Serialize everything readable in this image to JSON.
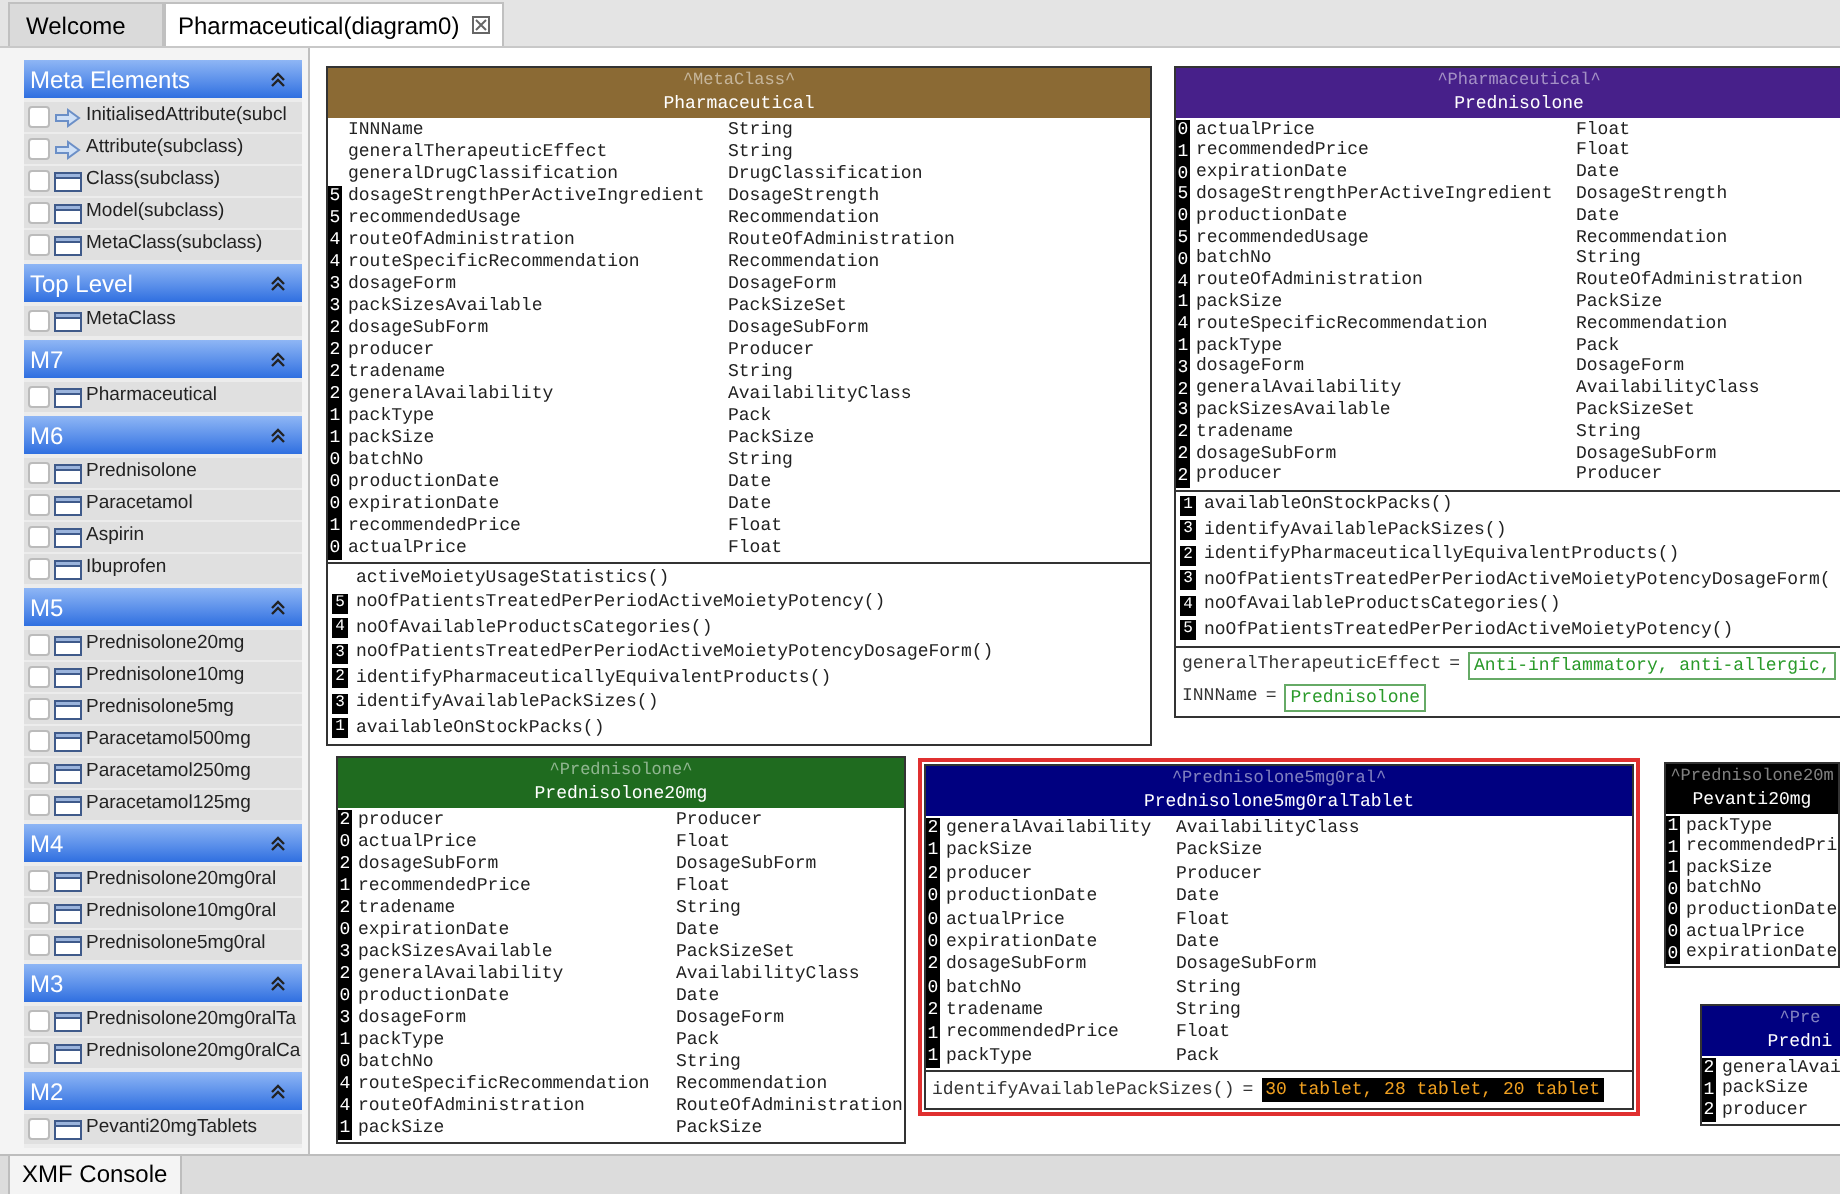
{
  "tabs": [
    {
      "label": "Welcome",
      "selected": false,
      "closable": false
    },
    {
      "label": "Pharmaceutical(diagram0)",
      "selected": true,
      "closable": true
    }
  ],
  "palette": {
    "sections": [
      {
        "title": "Meta Elements",
        "items": [
          {
            "label": "InitialisedAttribute(subcl",
            "kind": "arrow",
            "checked": false
          },
          {
            "label": "Attribute(subclass)",
            "kind": "arrow",
            "checked": false
          },
          {
            "label": "Class(subclass)",
            "kind": "class",
            "checked": false
          },
          {
            "label": "Model(subclass)",
            "kind": "class",
            "checked": false
          },
          {
            "label": "MetaClass(subclass)",
            "kind": "class",
            "checked": false
          }
        ]
      },
      {
        "title": "Top Level",
        "items": [
          {
            "label": "MetaClass",
            "kind": "class",
            "checked": false
          }
        ]
      },
      {
        "title": "M7",
        "items": [
          {
            "label": "Pharmaceutical",
            "kind": "class",
            "checked": false
          }
        ]
      },
      {
        "title": "M6",
        "items": [
          {
            "label": "Prednisolone",
            "kind": "class",
            "checked": false
          },
          {
            "label": "Paracetamol",
            "kind": "class",
            "checked": false
          },
          {
            "label": "Aspirin",
            "kind": "class",
            "checked": false
          },
          {
            "label": "Ibuprofen",
            "kind": "class",
            "checked": false
          }
        ]
      },
      {
        "title": "M5",
        "items": [
          {
            "label": "Prednisolone20mg",
            "kind": "class",
            "checked": false
          },
          {
            "label": "Prednisolone10mg",
            "kind": "class",
            "checked": false
          },
          {
            "label": "Prednisolone5mg",
            "kind": "class",
            "checked": false
          },
          {
            "label": "Paracetamol500mg",
            "kind": "class",
            "checked": false
          },
          {
            "label": "Paracetamol250mg",
            "kind": "class",
            "checked": false
          },
          {
            "label": "Paracetamol125mg",
            "kind": "class",
            "checked": false
          }
        ]
      },
      {
        "title": "M4",
        "items": [
          {
            "label": "Prednisolone20mg0ral",
            "kind": "class",
            "checked": false
          },
          {
            "label": "Prednisolone10mg0ral",
            "kind": "class",
            "checked": false
          },
          {
            "label": "Prednisolone5mg0ral",
            "kind": "class",
            "checked": false
          }
        ]
      },
      {
        "title": "M3",
        "items": [
          {
            "label": "Prednisolone20mg0ralTa",
            "kind": "class",
            "checked": false
          },
          {
            "label": "Prednisolone20mg0ralCa",
            "kind": "class",
            "checked": false
          }
        ]
      },
      {
        "title": "M2",
        "items": [
          {
            "label": "Pevanti20mgTablets",
            "kind": "class",
            "checked": false
          }
        ]
      }
    ]
  },
  "diagram": {
    "nodes": [
      {
        "stereotype": "^MetaClass^",
        "name": "Pharmaceutical",
        "color": "#8b6a34",
        "selected": false,
        "attributes": [
          {
            "name": "INNName",
            "type": "String"
          },
          {
            "name": "generalTherapeuticEffect",
            "type": "String"
          },
          {
            "name": "generalDrugClassification",
            "type": "DrugClassification"
          },
          {
            "rank": "5",
            "name": "dosageStrengthPerActiveIngredient",
            "type": "DosageStrength"
          },
          {
            "rank": "5",
            "name": "recommendedUsage",
            "type": "Recommendation"
          },
          {
            "rank": "4",
            "name": "routeOfAdministration",
            "type": "RouteOfAdministration"
          },
          {
            "rank": "4",
            "name": "routeSpecificRecommendation",
            "type": "Recommendation"
          },
          {
            "rank": "3",
            "name": "dosageForm",
            "type": "DosageForm"
          },
          {
            "rank": "3",
            "name": "packSizesAvailable",
            "type": "PackSizeSet"
          },
          {
            "rank": "2",
            "name": "dosageSubForm",
            "type": "DosageSubForm"
          },
          {
            "rank": "2",
            "name": "producer",
            "type": "Producer"
          },
          {
            "rank": "2",
            "name": "tradename",
            "type": "String"
          },
          {
            "rank": "2",
            "name": "generalAvailability",
            "type": "AvailabilityClass"
          },
          {
            "rank": "1",
            "name": "packType",
            "type": "Pack"
          },
          {
            "rank": "1",
            "name": "packSize",
            "type": "PackSize"
          },
          {
            "rank": "0",
            "name": "batchNo",
            "type": "String"
          },
          {
            "rank": "0",
            "name": "productionDate",
            "type": "Date"
          },
          {
            "rank": "0",
            "name": "expirationDate",
            "type": "Date"
          },
          {
            "rank": "1",
            "name": "recommendedPrice",
            "type": "Float"
          },
          {
            "rank": "0",
            "name": "actualPrice",
            "type": "Float"
          }
        ],
        "operations": [
          {
            "name": "activeMoietyUsageStatistics()"
          },
          {
            "rank": "5",
            "name": "noOfPatientsTreatedPerPeriodActiveMoietyPotency()"
          },
          {
            "rank": "4",
            "name": "noOfAvailableProductsCategories()"
          },
          {
            "rank": "3",
            "name": "noOfPatientsTreatedPerPeriodActiveMoietyPotencyDosageForm()"
          },
          {
            "rank": "2",
            "name": "identifyPharmaceuticallyEquivalentProducts()"
          },
          {
            "rank": "3",
            "name": "identifyAvailablePackSizes()"
          },
          {
            "rank": "1",
            "name": "availableOnStockPacks()"
          }
        ]
      },
      {
        "stereotype": "^Pharmaceutical^",
        "name": "Prednisolone",
        "color": "#47208a",
        "selected": false,
        "attributes": [
          {
            "rank": "0",
            "name": "actualPrice",
            "type": "Float"
          },
          {
            "rank": "1",
            "name": "recommendedPrice",
            "type": "Float"
          },
          {
            "rank": "0",
            "name": "expirationDate",
            "type": "Date"
          },
          {
            "rank": "5",
            "name": "dosageStrengthPerActiveIngredient",
            "type": "DosageStrength"
          },
          {
            "rank": "0",
            "name": "productionDate",
            "type": "Date"
          },
          {
            "rank": "5",
            "name": "recommendedUsage",
            "type": "Recommendation"
          },
          {
            "rank": "0",
            "name": "batchNo",
            "type": "String"
          },
          {
            "rank": "4",
            "name": "routeOfAdministration",
            "type": "RouteOfAdministration"
          },
          {
            "rank": "1",
            "name": "packSize",
            "type": "PackSize"
          },
          {
            "rank": "4",
            "name": "routeSpecificRecommendation",
            "type": "Recommendation"
          },
          {
            "rank": "1",
            "name": "packType",
            "type": "Pack"
          },
          {
            "rank": "3",
            "name": "dosageForm",
            "type": "DosageForm"
          },
          {
            "rank": "2",
            "name": "generalAvailability",
            "type": "AvailabilityClass"
          },
          {
            "rank": "3",
            "name": "packSizesAvailable",
            "type": "PackSizeSet"
          },
          {
            "rank": "2",
            "name": "tradename",
            "type": "String"
          },
          {
            "rank": "2",
            "name": "dosageSubForm",
            "type": "DosageSubForm"
          },
          {
            "rank": "2",
            "name": "producer",
            "type": "Producer"
          }
        ],
        "operations": [
          {
            "rank": "1",
            "name": "availableOnStockPacks()"
          },
          {
            "rank": "3",
            "name": "identifyAvailablePackSizes()"
          },
          {
            "rank": "2",
            "name": "identifyPharmaceuticallyEquivalentProducts()"
          },
          {
            "rank": "3",
            "name": "noOfPatientsTreatedPerPeriodActiveMoietyPotencyDosageForm("
          },
          {
            "rank": "4",
            "name": "noOfAvailableProductsCategories()"
          },
          {
            "rank": "5",
            "name": "noOfPatientsTreatedPerPeriodActiveMoietyPotency()"
          }
        ],
        "slots": [
          {
            "name": "generalTherapeuticEffect",
            "operator": "=",
            "value": "Anti-inflammatory, anti-allergic,",
            "kind": "text"
          },
          {
            "name": "INNName",
            "operator": "=",
            "value": "Prednisolone",
            "kind": "text"
          }
        ]
      },
      {
        "stereotype": "^Prednisolone^",
        "name": "Prednisolone20mg",
        "color": "#1f6b1f",
        "selected": false,
        "attributes": [
          {
            "rank": "2",
            "name": "producer",
            "type": "Producer"
          },
          {
            "rank": "0",
            "name": "actualPrice",
            "type": "Float"
          },
          {
            "rank": "2",
            "name": "dosageSubForm",
            "type": "DosageSubForm"
          },
          {
            "rank": "1",
            "name": "recommendedPrice",
            "type": "Float"
          },
          {
            "rank": "2",
            "name": "tradename",
            "type": "String"
          },
          {
            "rank": "0",
            "name": "expirationDate",
            "type": "Date"
          },
          {
            "rank": "3",
            "name": "packSizesAvailable",
            "type": "PackSizeSet"
          },
          {
            "rank": "2",
            "name": "generalAvailability",
            "type": "AvailabilityClass"
          },
          {
            "rank": "0",
            "name": "productionDate",
            "type": "Date"
          },
          {
            "rank": "3",
            "name": "dosageForm",
            "type": "DosageForm"
          },
          {
            "rank": "1",
            "name": "packType",
            "type": "Pack"
          },
          {
            "rank": "0",
            "name": "batchNo",
            "type": "String"
          },
          {
            "rank": "4",
            "name": "routeSpecificRecommendation",
            "type": "Recommendation"
          },
          {
            "rank": "4",
            "name": "routeOfAdministration",
            "type": "RouteOfAdministration"
          },
          {
            "rank": "1",
            "name": "packSize",
            "type": "PackSize"
          }
        ]
      },
      {
        "stereotype": "^Prednisolone5mg0ral^",
        "name": "Prednisolone5mg0ralTablet",
        "color": "#000080",
        "selected": true,
        "attributes": [
          {
            "rank": "2",
            "name": "generalAvailability",
            "type": "AvailabilityClass"
          },
          {
            "rank": "1",
            "name": "packSize",
            "type": "PackSize"
          },
          {
            "rank": "2",
            "name": "producer",
            "type": "Producer"
          },
          {
            "rank": "0",
            "name": "productionDate",
            "type": "Date"
          },
          {
            "rank": "0",
            "name": "actualPrice",
            "type": "Float"
          },
          {
            "rank": "0",
            "name": "expirationDate",
            "type": "Date"
          },
          {
            "rank": "2",
            "name": "dosageSubForm",
            "type": "DosageSubForm"
          },
          {
            "rank": "0",
            "name": "batchNo",
            "type": "String"
          },
          {
            "rank": "2",
            "name": "tradename",
            "type": "String"
          },
          {
            "rank": "1",
            "name": "recommendedPrice",
            "type": "Float"
          },
          {
            "rank": "1",
            "name": "packType",
            "type": "Pack"
          }
        ],
        "slots": [
          {
            "name": "identifyAvailablePackSizes()",
            "operator": "=",
            "value": "30 tablet, 28 tablet, 20 tablet",
            "kind": "list"
          }
        ]
      },
      {
        "stereotype": "^Prednisolone20m",
        "name": "Pevanti20mg",
        "color": "#000000",
        "selected": false,
        "attributes": [
          {
            "rank": "1",
            "name": "packType"
          },
          {
            "rank": "1",
            "name": "recommendedPri"
          },
          {
            "rank": "1",
            "name": "packSize"
          },
          {
            "rank": "0",
            "name": "batchNo"
          },
          {
            "rank": "0",
            "name": "productionDate"
          },
          {
            "rank": "0",
            "name": "actualPrice"
          },
          {
            "rank": "0",
            "name": "expirationDate"
          }
        ]
      },
      {
        "stereotype": "^Pre",
        "name": "Predni",
        "color": "#000080",
        "selected": false,
        "attributes": [
          {
            "rank": "2",
            "name": "generalAvai"
          },
          {
            "rank": "1",
            "name": "packSize"
          },
          {
            "rank": "2",
            "name": "producer"
          }
        ]
      }
    ]
  },
  "console": {
    "tab": "XMF Console"
  }
}
